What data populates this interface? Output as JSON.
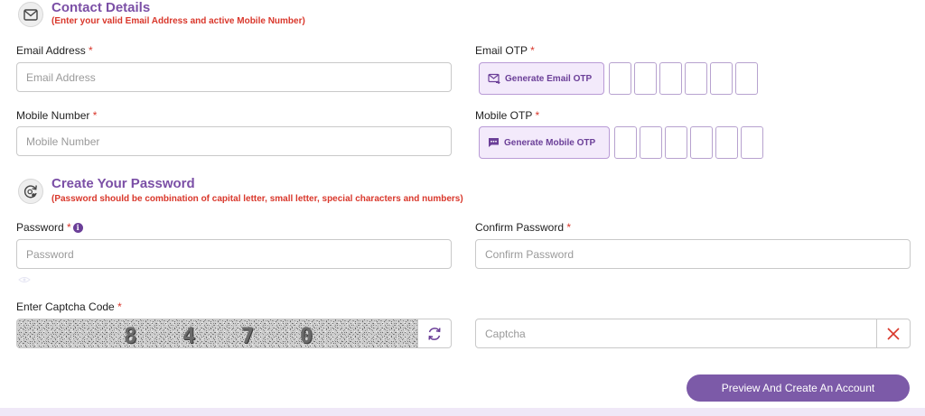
{
  "contact": {
    "title": "Contact Details",
    "note": "(Enter your valid Email Address and active Mobile Number)",
    "email_label": "Email Address",
    "email_placeholder": "Email Address",
    "email_otp_label": "Email OTP",
    "generate_email_otp": "Generate Email OTP",
    "mobile_label": "Mobile Number",
    "mobile_placeholder": "Mobile Number",
    "mobile_otp_label": "Mobile OTP",
    "generate_mobile_otp": "Generate Mobile OTP",
    "required_mark": "*"
  },
  "password": {
    "title": "Create Your Password",
    "note": "(Password should be combination of capital letter, small letter, special characters and numbers)",
    "password_label": "Password",
    "password_placeholder": "Password",
    "confirm_label": "Confirm Password",
    "confirm_placeholder": "Confirm Password",
    "required_mark": "*"
  },
  "captcha": {
    "label": "Enter Captcha Code",
    "required_mark": "*",
    "code": "8 4 7 0",
    "input_placeholder": "Captcha"
  },
  "actions": {
    "submit_label": "Preview And Create An Account"
  },
  "colors": {
    "accent": "#7c5aa8",
    "required": "#d9372b"
  }
}
